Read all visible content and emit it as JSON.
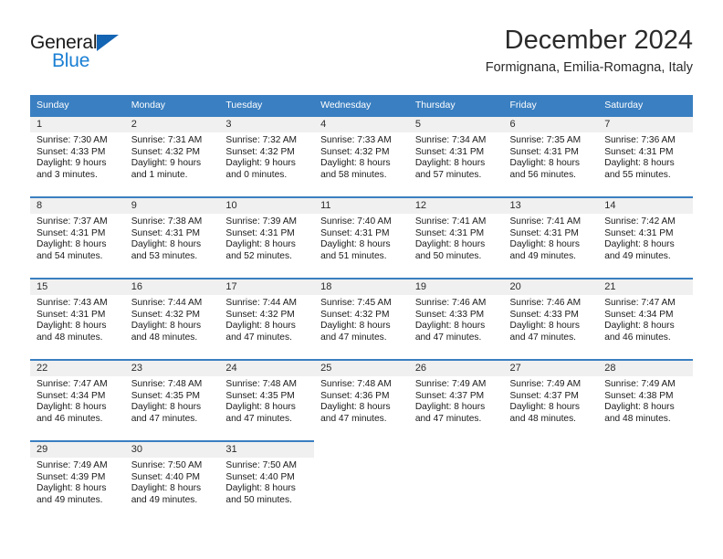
{
  "brand": {
    "name_part1": "General",
    "name_part2": "Blue",
    "triangle_color": "#1464b4",
    "blue_color": "#1a7fd4"
  },
  "header": {
    "title": "December 2024",
    "subtitle": "Formignana, Emilia-Romagna, Italy"
  },
  "theme": {
    "header_bg": "#3a7fc1",
    "daynum_bg": "#f0f0f0",
    "row_rule": "#3a7fc1"
  },
  "weekday_headers": [
    "Sunday",
    "Monday",
    "Tuesday",
    "Wednesday",
    "Thursday",
    "Friday",
    "Saturday"
  ],
  "weeks": [
    [
      {
        "day": "1",
        "sunrise": "Sunrise: 7:30 AM",
        "sunset": "Sunset: 4:33 PM",
        "daylight": "Daylight: 9 hours and 3 minutes."
      },
      {
        "day": "2",
        "sunrise": "Sunrise: 7:31 AM",
        "sunset": "Sunset: 4:32 PM",
        "daylight": "Daylight: 9 hours and 1 minute."
      },
      {
        "day": "3",
        "sunrise": "Sunrise: 7:32 AM",
        "sunset": "Sunset: 4:32 PM",
        "daylight": "Daylight: 9 hours and 0 minutes."
      },
      {
        "day": "4",
        "sunrise": "Sunrise: 7:33 AM",
        "sunset": "Sunset: 4:32 PM",
        "daylight": "Daylight: 8 hours and 58 minutes."
      },
      {
        "day": "5",
        "sunrise": "Sunrise: 7:34 AM",
        "sunset": "Sunset: 4:31 PM",
        "daylight": "Daylight: 8 hours and 57 minutes."
      },
      {
        "day": "6",
        "sunrise": "Sunrise: 7:35 AM",
        "sunset": "Sunset: 4:31 PM",
        "daylight": "Daylight: 8 hours and 56 minutes."
      },
      {
        "day": "7",
        "sunrise": "Sunrise: 7:36 AM",
        "sunset": "Sunset: 4:31 PM",
        "daylight": "Daylight: 8 hours and 55 minutes."
      }
    ],
    [
      {
        "day": "8",
        "sunrise": "Sunrise: 7:37 AM",
        "sunset": "Sunset: 4:31 PM",
        "daylight": "Daylight: 8 hours and 54 minutes."
      },
      {
        "day": "9",
        "sunrise": "Sunrise: 7:38 AM",
        "sunset": "Sunset: 4:31 PM",
        "daylight": "Daylight: 8 hours and 53 minutes."
      },
      {
        "day": "10",
        "sunrise": "Sunrise: 7:39 AM",
        "sunset": "Sunset: 4:31 PM",
        "daylight": "Daylight: 8 hours and 52 minutes."
      },
      {
        "day": "11",
        "sunrise": "Sunrise: 7:40 AM",
        "sunset": "Sunset: 4:31 PM",
        "daylight": "Daylight: 8 hours and 51 minutes."
      },
      {
        "day": "12",
        "sunrise": "Sunrise: 7:41 AM",
        "sunset": "Sunset: 4:31 PM",
        "daylight": "Daylight: 8 hours and 50 minutes."
      },
      {
        "day": "13",
        "sunrise": "Sunrise: 7:41 AM",
        "sunset": "Sunset: 4:31 PM",
        "daylight": "Daylight: 8 hours and 49 minutes."
      },
      {
        "day": "14",
        "sunrise": "Sunrise: 7:42 AM",
        "sunset": "Sunset: 4:31 PM",
        "daylight": "Daylight: 8 hours and 49 minutes."
      }
    ],
    [
      {
        "day": "15",
        "sunrise": "Sunrise: 7:43 AM",
        "sunset": "Sunset: 4:31 PM",
        "daylight": "Daylight: 8 hours and 48 minutes."
      },
      {
        "day": "16",
        "sunrise": "Sunrise: 7:44 AM",
        "sunset": "Sunset: 4:32 PM",
        "daylight": "Daylight: 8 hours and 48 minutes."
      },
      {
        "day": "17",
        "sunrise": "Sunrise: 7:44 AM",
        "sunset": "Sunset: 4:32 PM",
        "daylight": "Daylight: 8 hours and 47 minutes."
      },
      {
        "day": "18",
        "sunrise": "Sunrise: 7:45 AM",
        "sunset": "Sunset: 4:32 PM",
        "daylight": "Daylight: 8 hours and 47 minutes."
      },
      {
        "day": "19",
        "sunrise": "Sunrise: 7:46 AM",
        "sunset": "Sunset: 4:33 PM",
        "daylight": "Daylight: 8 hours and 47 minutes."
      },
      {
        "day": "20",
        "sunrise": "Sunrise: 7:46 AM",
        "sunset": "Sunset: 4:33 PM",
        "daylight": "Daylight: 8 hours and 47 minutes."
      },
      {
        "day": "21",
        "sunrise": "Sunrise: 7:47 AM",
        "sunset": "Sunset: 4:34 PM",
        "daylight": "Daylight: 8 hours and 46 minutes."
      }
    ],
    [
      {
        "day": "22",
        "sunrise": "Sunrise: 7:47 AM",
        "sunset": "Sunset: 4:34 PM",
        "daylight": "Daylight: 8 hours and 46 minutes."
      },
      {
        "day": "23",
        "sunrise": "Sunrise: 7:48 AM",
        "sunset": "Sunset: 4:35 PM",
        "daylight": "Daylight: 8 hours and 47 minutes."
      },
      {
        "day": "24",
        "sunrise": "Sunrise: 7:48 AM",
        "sunset": "Sunset: 4:35 PM",
        "daylight": "Daylight: 8 hours and 47 minutes."
      },
      {
        "day": "25",
        "sunrise": "Sunrise: 7:48 AM",
        "sunset": "Sunset: 4:36 PM",
        "daylight": "Daylight: 8 hours and 47 minutes."
      },
      {
        "day": "26",
        "sunrise": "Sunrise: 7:49 AM",
        "sunset": "Sunset: 4:37 PM",
        "daylight": "Daylight: 8 hours and 47 minutes."
      },
      {
        "day": "27",
        "sunrise": "Sunrise: 7:49 AM",
        "sunset": "Sunset: 4:37 PM",
        "daylight": "Daylight: 8 hours and 48 minutes."
      },
      {
        "day": "28",
        "sunrise": "Sunrise: 7:49 AM",
        "sunset": "Sunset: 4:38 PM",
        "daylight": "Daylight: 8 hours and 48 minutes."
      }
    ],
    [
      {
        "day": "29",
        "sunrise": "Sunrise: 7:49 AM",
        "sunset": "Sunset: 4:39 PM",
        "daylight": "Daylight: 8 hours and 49 minutes."
      },
      {
        "day": "30",
        "sunrise": "Sunrise: 7:50 AM",
        "sunset": "Sunset: 4:40 PM",
        "daylight": "Daylight: 8 hours and 49 minutes."
      },
      {
        "day": "31",
        "sunrise": "Sunrise: 7:50 AM",
        "sunset": "Sunset: 4:40 PM",
        "daylight": "Daylight: 8 hours and 50 minutes."
      },
      null,
      null,
      null,
      null
    ]
  ]
}
